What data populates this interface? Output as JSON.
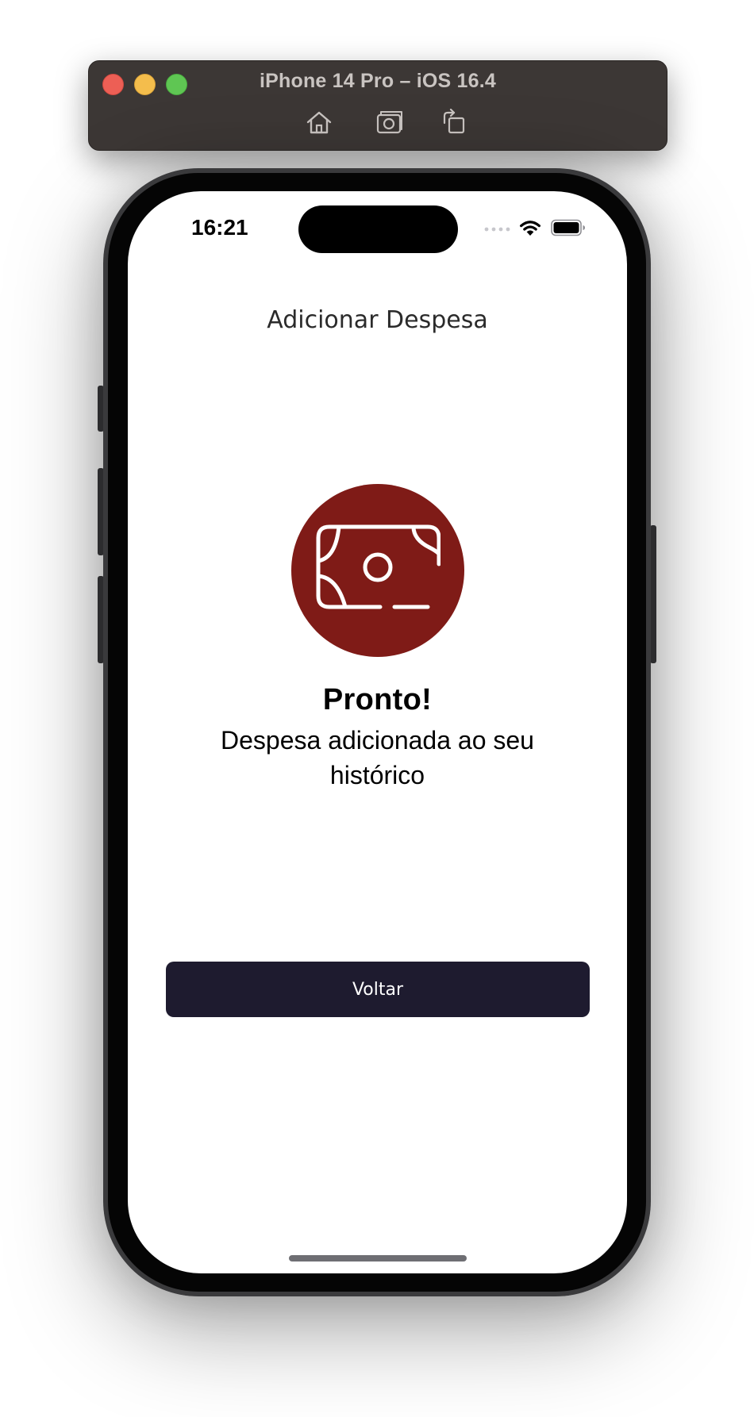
{
  "simulator": {
    "title": "iPhone 14 Pro – iOS 16.4",
    "toolbar": {
      "home_icon": "home-icon",
      "screenshot_icon": "camera-icon",
      "rotate_icon": "rotate-icon"
    }
  },
  "status_bar": {
    "time": "16:21",
    "icons": [
      "signal-icon",
      "wifi-icon",
      "battery-icon"
    ]
  },
  "screen": {
    "nav_title": "Adicionar Despesa",
    "icon": "money-bill-icon",
    "success_title": "Pronto!",
    "success_message": "Despesa adicionada ao seu histórico",
    "back_button_label": "Voltar"
  },
  "colors": {
    "accent_circle": "#7f1b17",
    "button_background": "#1e1b2f",
    "button_text": "#ffffff",
    "screen_background": "#ffffff"
  }
}
